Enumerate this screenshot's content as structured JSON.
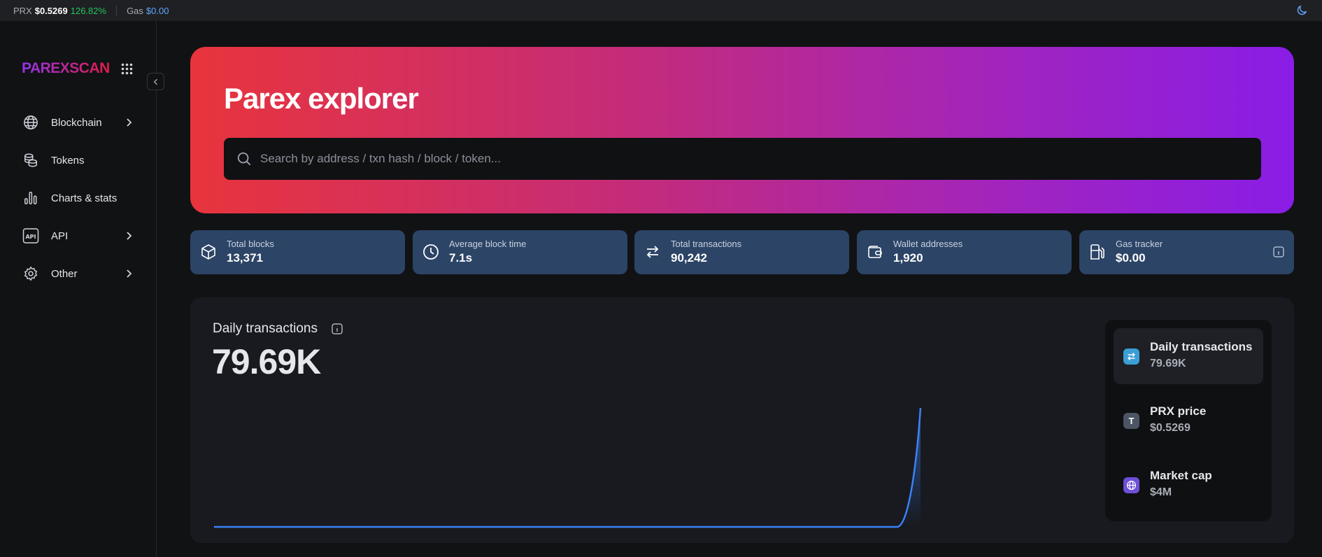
{
  "topbar": {
    "token_symbol": "PRX",
    "token_price": "$0.5269",
    "token_change": "126.82%",
    "gas_label": "Gas",
    "gas_value": "$0.00"
  },
  "sidebar": {
    "logo": "PAREXSCAN",
    "items": [
      {
        "label": "Blockchain",
        "icon": "globe-icon",
        "has_submenu": true
      },
      {
        "label": "Tokens",
        "icon": "coins-icon",
        "has_submenu": false
      },
      {
        "label": "Charts & stats",
        "icon": "bar-chart-icon",
        "has_submenu": false
      },
      {
        "label": "API",
        "icon": "api-icon",
        "has_submenu": true
      },
      {
        "label": "Other",
        "icon": "gear-icon",
        "has_submenu": true
      }
    ]
  },
  "hero": {
    "title": "Parex explorer",
    "search_placeholder": "Search by address / txn hash / block / token..."
  },
  "stats": [
    {
      "label": "Total blocks",
      "value": "13,371",
      "icon": "cube-icon"
    },
    {
      "label": "Average block time",
      "value": "7.1s",
      "icon": "clock-icon"
    },
    {
      "label": "Total transactions",
      "value": "90,242",
      "icon": "transfer-icon"
    },
    {
      "label": "Wallet addresses",
      "value": "1,920",
      "icon": "wallet-icon"
    },
    {
      "label": "Gas tracker",
      "value": "$0.00",
      "icon": "fuel-icon"
    }
  ],
  "chart_panel": {
    "title": "Daily transactions",
    "value": "79.69K"
  },
  "side_card": [
    {
      "title": "Daily transactions",
      "value": "79.69K",
      "icon": "transfer-icon",
      "color": "#3b9fd6",
      "active": true
    },
    {
      "title": "PRX price",
      "value": "$0.5269",
      "icon": "token-t-icon",
      "badge_text": "T",
      "color": "#4b5563",
      "active": false
    },
    {
      "title": "Market cap",
      "value": "$4M",
      "icon": "globe-icon",
      "color": "#6d4fd8",
      "active": false
    }
  ],
  "colors": {
    "accent_blue": "#3b82f6",
    "positive": "#22c55e",
    "hero_gradient_start": "#e8343c",
    "hero_gradient_end": "#8a1de6",
    "stat_card_bg": "#2c4466"
  },
  "chart_data": {
    "type": "area",
    "title": "Daily transactions",
    "series": [
      {
        "values": [
          0,
          0,
          0,
          0,
          0,
          0,
          0,
          0,
          0,
          0,
          0,
          0,
          0,
          0,
          0,
          0,
          0,
          0,
          0,
          0,
          0,
          0,
          0,
          0,
          0,
          0,
          0,
          0,
          0,
          0,
          79690
        ]
      }
    ],
    "grid": false,
    "legend": "none"
  }
}
